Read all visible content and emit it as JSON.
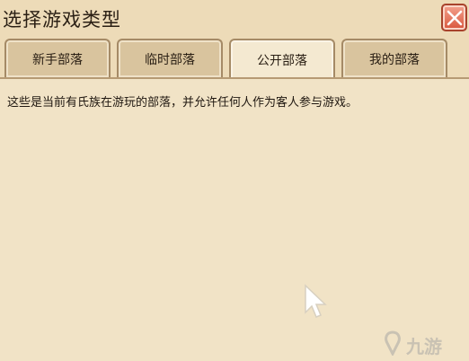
{
  "dialog": {
    "title": "选择游戏类型"
  },
  "tabs": [
    {
      "label": "新手部落",
      "active": false
    },
    {
      "label": "临时部落",
      "active": false
    },
    {
      "label": "公开部落",
      "active": true
    },
    {
      "label": "我的部落",
      "active": false
    }
  ],
  "content": {
    "description": "这些是当前有氏族在游玩的部落，并允许任何人作为客人参与游戏。"
  },
  "watermark": {
    "text": "九游"
  },
  "colors": {
    "panel_bg": "#eddbb8",
    "active_tab_bg": "#f4e9d1",
    "inactive_tab_bg": "#d9c49e",
    "close_red": "#d9563c"
  }
}
